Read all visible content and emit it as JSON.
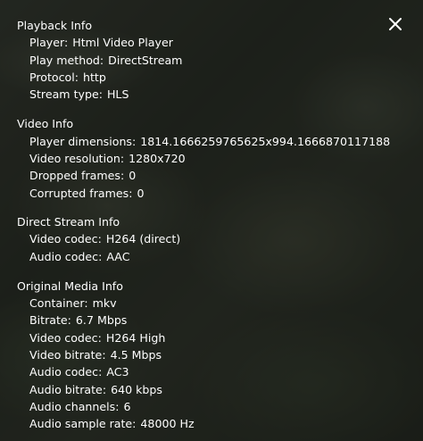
{
  "close_icon": "close-icon",
  "sections": [
    {
      "title": "Playback Info",
      "rows": [
        {
          "label": "Player",
          "value": "Html Video Player"
        },
        {
          "label": "Play method",
          "value": "DirectStream"
        },
        {
          "label": "Protocol",
          "value": "http"
        },
        {
          "label": "Stream type",
          "value": "HLS"
        }
      ]
    },
    {
      "title": "Video Info",
      "rows": [
        {
          "label": "Player dimensions",
          "value": "1814.1666259765625x994.1666870117188"
        },
        {
          "label": "Video resolution",
          "value": "1280x720"
        },
        {
          "label": "Dropped frames",
          "value": "0"
        },
        {
          "label": "Corrupted frames",
          "value": "0"
        }
      ]
    },
    {
      "title": "Direct Stream Info",
      "rows": [
        {
          "label": "Video codec",
          "value": "H264 (direct)"
        },
        {
          "label": "Audio codec",
          "value": "AAC"
        }
      ]
    },
    {
      "title": "Original Media Info",
      "rows": [
        {
          "label": "Container",
          "value": "mkv"
        },
        {
          "label": "Bitrate",
          "value": "6.7 Mbps"
        },
        {
          "label": "Video codec",
          "value": "H264 High"
        },
        {
          "label": "Video bitrate",
          "value": "4.5 Mbps"
        },
        {
          "label": "Audio codec",
          "value": "AC3"
        },
        {
          "label": "Audio bitrate",
          "value": "640 kbps"
        },
        {
          "label": "Audio channels",
          "value": "6"
        },
        {
          "label": "Audio sample rate",
          "value": "48000 Hz"
        }
      ]
    }
  ]
}
